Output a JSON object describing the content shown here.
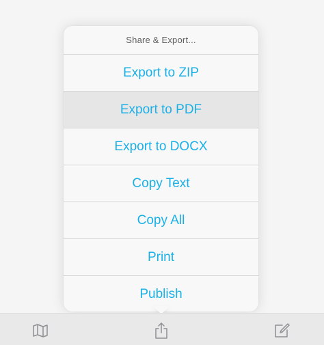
{
  "popover": {
    "title": "Share & Export...",
    "items": [
      {
        "label": "Export to ZIP"
      },
      {
        "label": "Export to PDF"
      },
      {
        "label": "Export to DOCX"
      },
      {
        "label": "Copy Text"
      },
      {
        "label": "Copy All"
      },
      {
        "label": "Print"
      },
      {
        "label": "Publish"
      }
    ],
    "highlighted_index": 1
  },
  "toolbar": {
    "icons": [
      "map-icon",
      "share-icon",
      "compose-icon"
    ]
  },
  "colors": {
    "accent": "#1ab0e6",
    "header_text": "#5c5c5c",
    "highlight": "#e6e6e6",
    "icon_gray": "#8e8e93"
  }
}
